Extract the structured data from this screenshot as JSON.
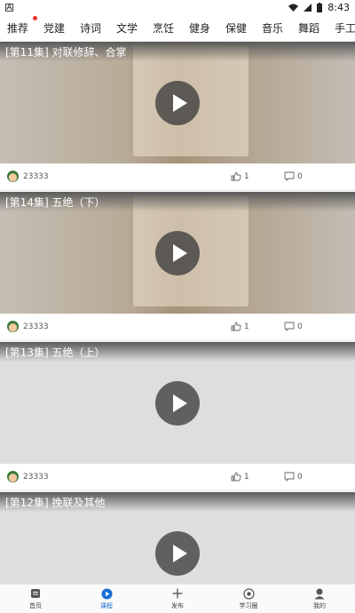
{
  "status_bar": {
    "time": "8:43"
  },
  "tabs": [
    {
      "label": "推荐",
      "has_badge": true
    },
    {
      "label": "党建"
    },
    {
      "label": "诗词"
    },
    {
      "label": "文学"
    },
    {
      "label": "烹饪"
    },
    {
      "label": "健身"
    },
    {
      "label": "保健"
    },
    {
      "label": "音乐"
    },
    {
      "label": "舞蹈"
    },
    {
      "label": "手工"
    }
  ],
  "cards": [
    {
      "title": "[第11集] 对联修辞、合掌",
      "author": "23333",
      "likes": "1",
      "comments": "0",
      "has_poster": true
    },
    {
      "title": "[第14集] 五绝（下）",
      "author": "23333",
      "likes": "1",
      "comments": "0",
      "has_poster": true
    },
    {
      "title": "[第13集] 五绝（上）",
      "author": "23333",
      "likes": "1",
      "comments": "0",
      "has_poster": false
    },
    {
      "title": "[第12集] 挽联及其他",
      "author": "",
      "likes": "",
      "comments": "",
      "has_poster": false
    }
  ],
  "bottom_nav": [
    {
      "label": "首页",
      "icon": "home-icon"
    },
    {
      "label": "课程",
      "icon": "course-play-icon",
      "active": true
    },
    {
      "label": "发布",
      "icon": "plus-icon"
    },
    {
      "label": "学习圈",
      "icon": "circle-icon"
    },
    {
      "label": "我的",
      "icon": "profile-icon"
    }
  ],
  "colors": {
    "accent": "#1a6fd6",
    "badge": "#e6322a"
  }
}
